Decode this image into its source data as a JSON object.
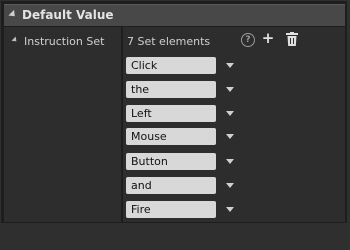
{
  "category": {
    "title": "Default Value"
  },
  "property": {
    "label": "Instruction Set",
    "count_text": "7 Set elements",
    "elements": [
      "Click",
      "the",
      "Left",
      "Mouse",
      "Button",
      "and",
      "Fire"
    ]
  },
  "icons": {
    "help": "question-circle-icon",
    "add": "plus-icon",
    "delete": "trash-icon"
  }
}
